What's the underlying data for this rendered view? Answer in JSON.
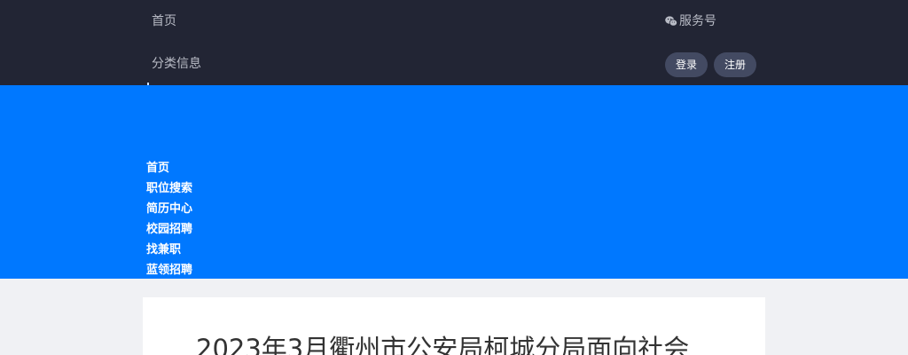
{
  "topnav": {
    "home": "首页",
    "classified": "分类信息"
  },
  "service": {
    "label": "服务号",
    "icon": "wechat-icon"
  },
  "auth": {
    "login": "登录",
    "register": "注册"
  },
  "mainnav": {
    "items": [
      "首页",
      "职位搜索",
      "简历中心",
      "校园招聘",
      "找兼职",
      "蓝领招聘"
    ]
  },
  "article": {
    "title": "2023年3月衢州市公安局柯城分局面向社会"
  },
  "colors": {
    "topbar": "#222534",
    "accent": "#0078ff",
    "pill": "#434a62",
    "background": "#f0f1f4"
  }
}
